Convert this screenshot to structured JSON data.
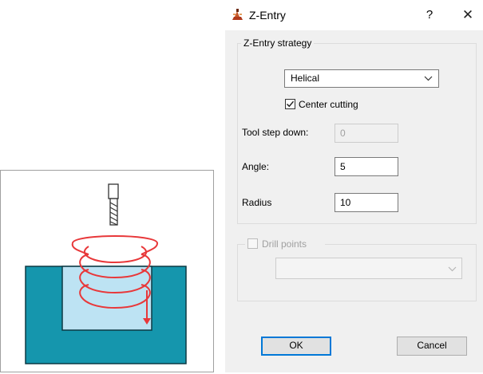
{
  "dialog": {
    "title": "Z-Entry",
    "help_glyph": "?",
    "close_glyph": "✕",
    "app_icon": "cnc-mill-icon"
  },
  "zentry_group": {
    "title": "Z-Entry strategy",
    "strategy_value": "Helical",
    "center_cutting_label": "Center cutting",
    "center_cutting_checked": true,
    "tool_step_down_label": "Tool step down:",
    "tool_step_down_value": "0",
    "angle_label": "Angle:",
    "angle_value": "5",
    "radius_label": "Radius",
    "radius_value": "10"
  },
  "drill_group": {
    "title": "Drill points",
    "checked": false,
    "select_value": ""
  },
  "buttons": {
    "ok_label": "OK",
    "cancel_label": "Cancel"
  },
  "illustration": {
    "description_icon": "helical-entry-illustration",
    "stock_color": "#1596ad",
    "pocket_color": "#bde3f3",
    "helix_color": "#e8383a"
  }
}
